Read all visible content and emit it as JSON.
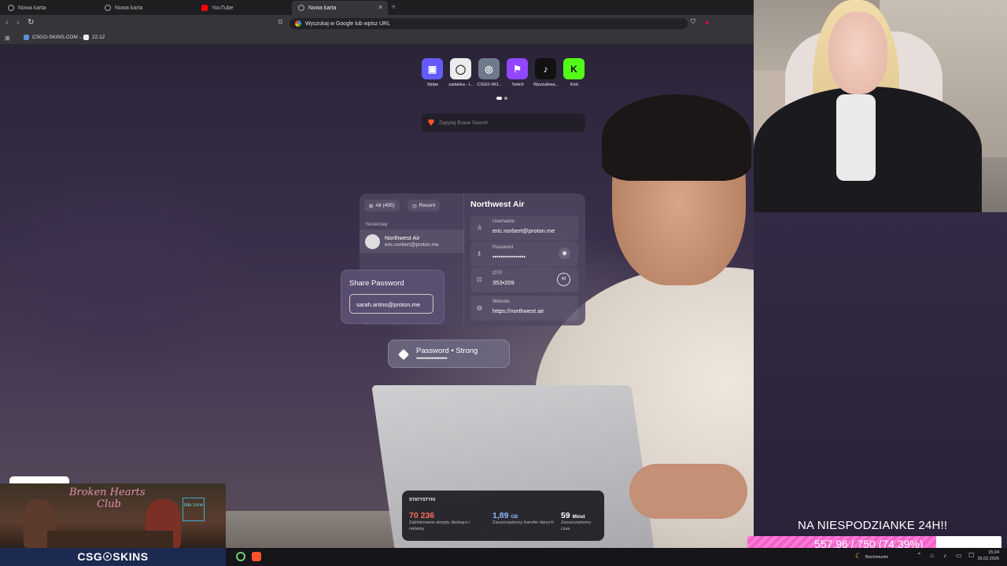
{
  "browser": {
    "tabs": [
      {
        "title": "Nowa karta",
        "active": false
      },
      {
        "title": "Nowa karta",
        "active": false
      },
      {
        "title": "YouTube",
        "active": false
      },
      {
        "title": "Nowa karta",
        "active": true
      }
    ],
    "address_placeholder": "Wyszukaj w Google lub wpisz URL",
    "bookmarks": [
      {
        "label": "CSGO-SKINS.COM -..."
      },
      {
        "label": "22.12"
      }
    ]
  },
  "speed_dials": [
    {
      "label": "Stripe",
      "color": "#635bff",
      "glyph": "▣"
    },
    {
      "label": "zadanka - I...",
      "color": "#ececec",
      "glyph": "◯"
    },
    {
      "label": "CSGO-SKI...",
      "color": "#6c7a8c",
      "glyph": "◎"
    },
    {
      "label": "Twitch",
      "color": "#9146ff",
      "glyph": "⚑"
    },
    {
      "label": "Wyszukiwa...",
      "color": "#111111",
      "glyph": "♪"
    },
    {
      "label": "Kick",
      "color": "#53fc18",
      "glyph": "K"
    }
  ],
  "search": {
    "placeholder": "Zapytaj Brave Search"
  },
  "wallpaper": {
    "password_manager": {
      "chip_all": "All (495)",
      "chip_recent": "Recent",
      "section": "Yesterday",
      "entry_name": "Northwest Air",
      "entry_email": "eric.norbert@proton.me",
      "detail_title": "Northwest Air",
      "username_label": "Username",
      "username_value": "eric.norbert@proton.me",
      "password_label": "Password",
      "password_value": "••••••••••••••••",
      "otp_label": "OTP",
      "otp_value": "353•209",
      "otp_timer": "43",
      "website_label": "Website",
      "website_value": "https://northwest.air"
    },
    "share": {
      "title": "Share Password",
      "email": "sarah.artino@proton.me"
    },
    "strength": {
      "title": "Password • Strong",
      "dots": "••••••••••••••••••••"
    }
  },
  "stats": {
    "title": "STATYSTYKI",
    "items": [
      {
        "value": "70 236",
        "unit": "",
        "desc": "Zablokowane skrypty śledzące i reklamy",
        "color": "#ff6b57"
      },
      {
        "value": "1,89",
        "unit": "GB",
        "desc": "Zaoszczędzony transfer danych",
        "color": "#8fb6ff"
      },
      {
        "value": "59",
        "unit": "Minut",
        "desc": "Zaoszczędzony czas",
        "color": "#ffffff"
      }
    ]
  },
  "stream": {
    "goal_title": "NA NIESPODZIANKE 24H!!",
    "goal_text": "557.96 / 750 (74.39%)",
    "goal_progress": 0.7439,
    "game_title_line1": "Broken Hearts",
    "game_title_line2": "Club",
    "game_sign": "tide zone",
    "sponsor": "CSG☉SKINS"
  },
  "taskbar": {
    "weather": "Bezchmurnie",
    "time": "15:24",
    "date": "25.02.2026"
  }
}
